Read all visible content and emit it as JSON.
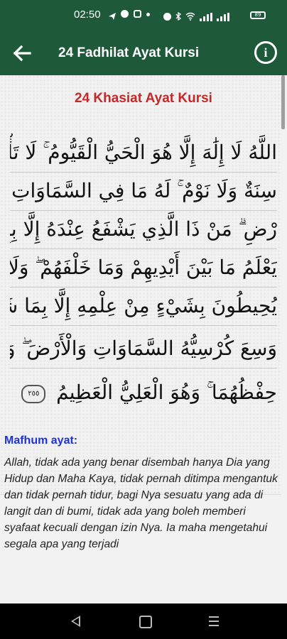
{
  "status_bar": {
    "time": "02:50",
    "battery": "89"
  },
  "app_bar": {
    "title": "24 Fadhilat Ayat Kursi",
    "back_icon": "arrow-left-icon",
    "info_icon": "info-icon"
  },
  "content": {
    "subtitle": "24 Khasiat Ayat Kursi",
    "ayat_lines": [
      "اللَّهُ لَا إِلَٰهَ إِلَّا هُوَ الْحَيُّ الْقَيُّومُ ۚ لَا تَأْخُذُهُ",
      "سِنَةٌ وَلَا نَوْمٌ ۚ لَهُ مَا فِي السَّمَاوَاتِ وَمَا فِي الْأَ",
      "رْضِ ۗ مَنْ ذَا الَّذِي يَشْفَعُ عِنْدَهُ إِلَّا بِإِذْنِهِ ۚ",
      "يَعْلَمُ مَا بَيْنَ أَيْدِيهِمْ وَمَا خَلْفَهُمْ ۖ وَلَا",
      "يُحِيطُونَ بِشَيْءٍ مِنْ عِلْمِهِ إِلَّا بِمَا شَاءَ ۚ",
      "وَسِعَ كُرْسِيُّهُ السَّمَاوَاتِ وَالْأَرْضَ ۖ وَلَا يَئُودُهُ",
      "حِفْظُهُمَا ۚ وَهُوَ الْعَلِيُّ الْعَظِيمُ"
    ],
    "ayah_number": "٢٥٥",
    "mafhum_label": "Mafhum ayat:",
    "translation": "Allah, tidak ada yang benar disembah hanya Dia yang Hidup dan Maha Kaya, tidak pernah ditimpa mengantuk dan tidak pernah tidur, bagi Nya sesuatu yang ada di langit dan di bumi, tidak ada yang boleh memberi syafaat kecuali dengan izin Nya. Ia maha mengetahui segala apa yang terjadi"
  },
  "colors": {
    "primary": "#1e5a3a",
    "subtitle": "#c62828",
    "mafhum": "#1f33d6"
  }
}
